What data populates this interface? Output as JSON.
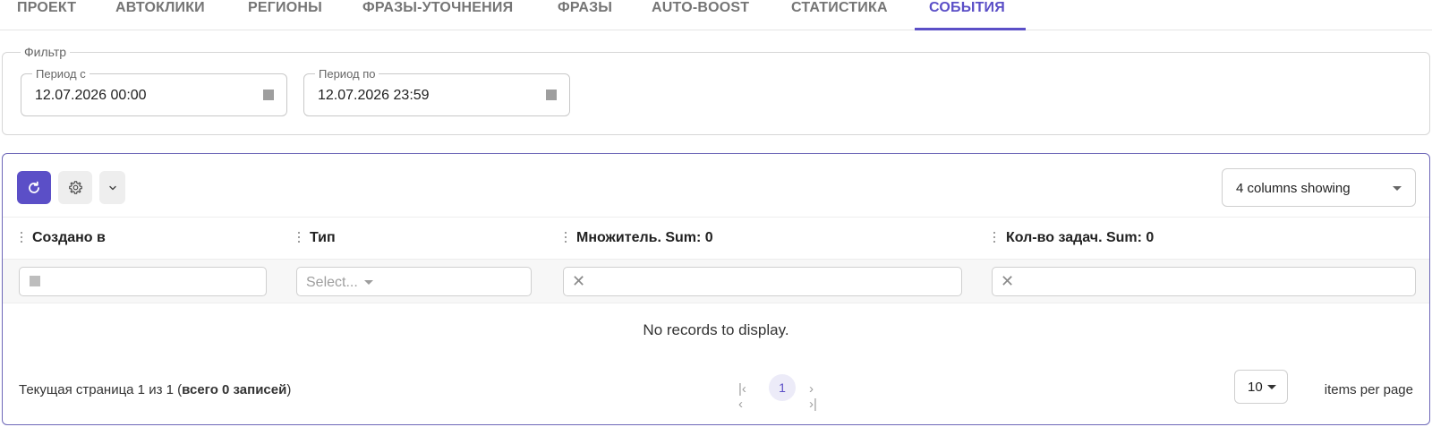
{
  "tabs": [
    {
      "label": "ПРОЕКТ",
      "active": false
    },
    {
      "label": "АВТОКЛИКИ",
      "active": false
    },
    {
      "label": "РЕГИОНЫ",
      "active": false
    },
    {
      "label": "ФРАЗЫ-УТОЧНЕНИЯ",
      "active": false
    },
    {
      "label": "ФРАЗЫ",
      "active": false
    },
    {
      "label": "AUTO-BOOST",
      "active": false
    },
    {
      "label": "СТАТИСТИКА",
      "active": false
    },
    {
      "label": "СОБЫТИЯ",
      "active": true
    }
  ],
  "filter": {
    "legend": "Фильтр",
    "period_from": {
      "label": "Период с",
      "value": "12.07.2026 00:00"
    },
    "period_to": {
      "label": "Период по",
      "value": "12.07.2026 23:59"
    }
  },
  "toolbar": {
    "refresh_icon": "refresh-icon",
    "settings_icon": "gear-icon",
    "expand_icon": "chevron-down-icon",
    "columns_selector": "4 columns showing"
  },
  "table": {
    "columns": [
      "Создано в",
      "Тип",
      "Множитель. Sum: 0",
      "Кол-во задач. Sum: 0"
    ],
    "filters": {
      "type_placeholder": "Select..."
    },
    "empty_message": "No records to display."
  },
  "footer": {
    "page_info_prefix": "Текущая страница 1 из 1 (",
    "page_info_bold": "всего 0 записей",
    "page_info_suffix": ")",
    "nav_first_prev": "|‹ ‹",
    "current_page": "1",
    "nav_next_last": "› ›|",
    "per_page_value": "10",
    "per_page_label": "items per page"
  },
  "colors": {
    "accent": "#5b4fc7",
    "panel_border": "#6e68b8"
  }
}
